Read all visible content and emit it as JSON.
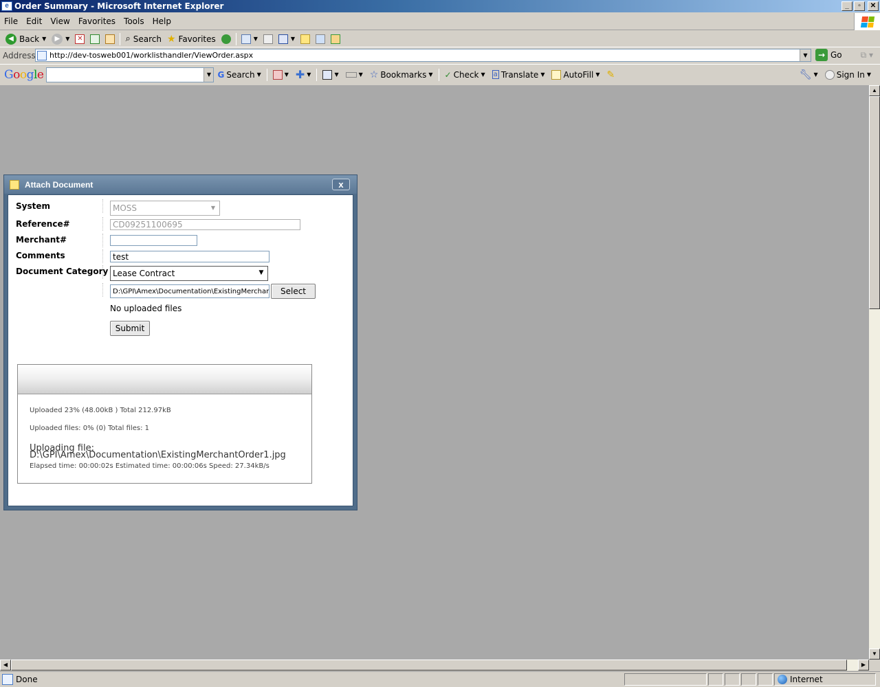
{
  "window": {
    "title": "Order Summary - Microsoft Internet Explorer",
    "controls": {
      "minimize": "_",
      "maximize": "▫",
      "close": "✕"
    }
  },
  "menu": {
    "items": [
      "File",
      "Edit",
      "View",
      "Favorites",
      "Tools",
      "Help"
    ]
  },
  "toolbar": {
    "back_label": "Back",
    "search_label": "Search",
    "favorites_label": "Favorites"
  },
  "address": {
    "label": "Address",
    "url": "http://dev-tosweb001/worklisthandler/ViewOrder.aspx",
    "go_label": "Go"
  },
  "google_toolbar": {
    "logo": "Google",
    "search_value": "",
    "search_label": "Search",
    "bookmarks_label": "Bookmarks",
    "check_label": "Check",
    "translate_label": "Translate",
    "autofill_label": "AutoFill",
    "signin_label": "Sign In"
  },
  "dialog": {
    "title": "Attach Document",
    "close_glyph": "x",
    "labels": {
      "system": "System",
      "reference": "Reference#",
      "merchant": "Merchant#",
      "comments": "Comments",
      "category": "Document Category"
    },
    "values": {
      "system": "MOSS",
      "reference": "CD09251100695",
      "merchant": "",
      "comments": "test",
      "category": "Lease Contract",
      "file_path": "D:\\GPI\\Amex\\Documentation\\ExistingMerchantC"
    },
    "select_button": "Select",
    "no_files_text": "No uploaded files",
    "submit_button": "Submit",
    "progress": {
      "uploaded_line": "Uploaded 23% (48.00kB ) Total 212.97kB",
      "files_line": "Uploaded files: 0% (0) Total files: 1",
      "uploading_label": "Uploading file:",
      "uploading_path": "D:\\GPI\\Amex\\Documentation\\ExistingMerchantOrder1.jpg",
      "timing_line": "Elapsed time: 00:00:02s Estimated time: 00:00:06s Speed: 27.34kB/s"
    }
  },
  "status": {
    "text": "Done",
    "zone": "Internet"
  }
}
